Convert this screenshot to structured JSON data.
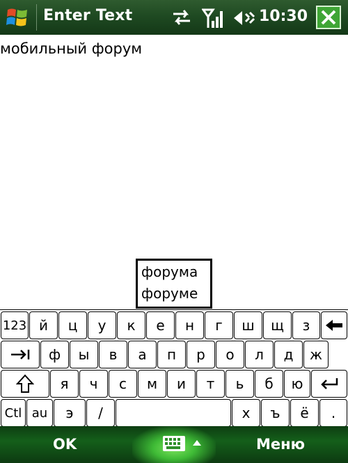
{
  "titlebar": {
    "title": "Enter Text",
    "time": "10:30",
    "start_icon": "windows-flag-icon",
    "status_icons": [
      "sync-arrows-icon",
      "signal-icon",
      "speaker-icon"
    ],
    "close_icon": "close-icon"
  },
  "text_area": {
    "value": "мобильный форум"
  },
  "suggestions": [
    "форума",
    "форуме"
  ],
  "keyboard": {
    "row1": [
      "123",
      "й",
      "ц",
      "у",
      "к",
      "е",
      "н",
      "г",
      "ш",
      "щ",
      "з"
    ],
    "row2": [
      "ф",
      "ы",
      "в",
      "а",
      "п",
      "р",
      "о",
      "л",
      "д",
      "ж"
    ],
    "row3": [
      "я",
      "ч",
      "с",
      "м",
      "и",
      "т",
      "ь",
      "б",
      "ю"
    ],
    "row4_left": [
      "Ctl",
      "au",
      "э",
      "/"
    ],
    "row4_right": [
      "х",
      "ъ",
      "ё",
      "."
    ],
    "icons": {
      "backspace": "backspace-arrow-icon",
      "tab": "tab-arrow-icon",
      "shift": "shift-arrow-icon",
      "enter": "enter-arrow-icon"
    }
  },
  "softkeys": {
    "left": "OK",
    "right": "Меню",
    "center_icon": "keyboard-icon"
  },
  "colors": {
    "titlebar_green": "#1f4a22",
    "close_button_green": "#3fa535",
    "softbar_glow": "#7ee35e"
  }
}
